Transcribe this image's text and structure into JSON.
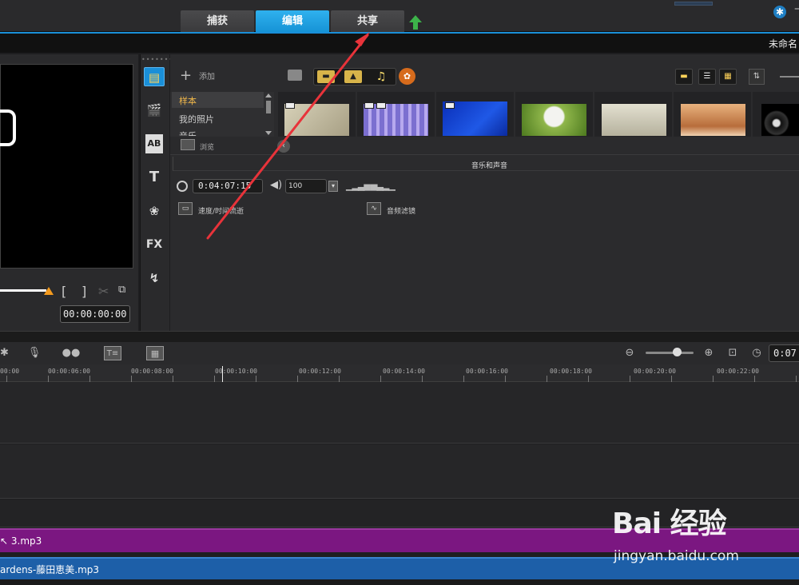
{
  "tabs": [
    {
      "label": "捕获"
    },
    {
      "label": "编辑"
    },
    {
      "label": "共享"
    }
  ],
  "project": {
    "title": "未命名"
  },
  "preview": {
    "timecode": "00:00:00:00",
    "mark_in": "[",
    "mark_out": "]"
  },
  "library": {
    "add_label": "添加",
    "folders": [
      {
        "label": "样本"
      },
      {
        "label": "我的照片"
      },
      {
        "label": "音乐"
      }
    ],
    "browse_label": "浏览",
    "thumbnail_colors": [
      "#c9c2aa",
      "#8c78cf",
      "#1040c8",
      "#7fa33a",
      "#cfc9b4",
      "#c98e5f",
      "#0a0a0a"
    ]
  },
  "audio_panel": {
    "title": "音乐和声音",
    "duration": "0:04:07:15",
    "volume": "100",
    "speed_label": "速度/时间流逝",
    "filter_label": "音频滤镜"
  },
  "timeline": {
    "timecode": "0:07",
    "ruler": [
      "00:00",
      "00:00:06:00",
      "00:00:08:00",
      "00:00:10:00",
      "00:00:12:00",
      "00:00:14:00",
      "00:00:16:00",
      "00:00:18:00",
      "00:00:20:00",
      "00:00:22:00"
    ],
    "voice_clip": "3.mp3",
    "music_clip": "ardens-藤田恵美.mp3"
  },
  "watermark": {
    "brand": "Bai 经验",
    "url": "jingyan.baidu.com"
  },
  "colors": {
    "accent": "#1a8fd8",
    "voice_clip": "#7b1781",
    "music_clip": "#1d5fa8",
    "annotation": "#e8333a"
  }
}
